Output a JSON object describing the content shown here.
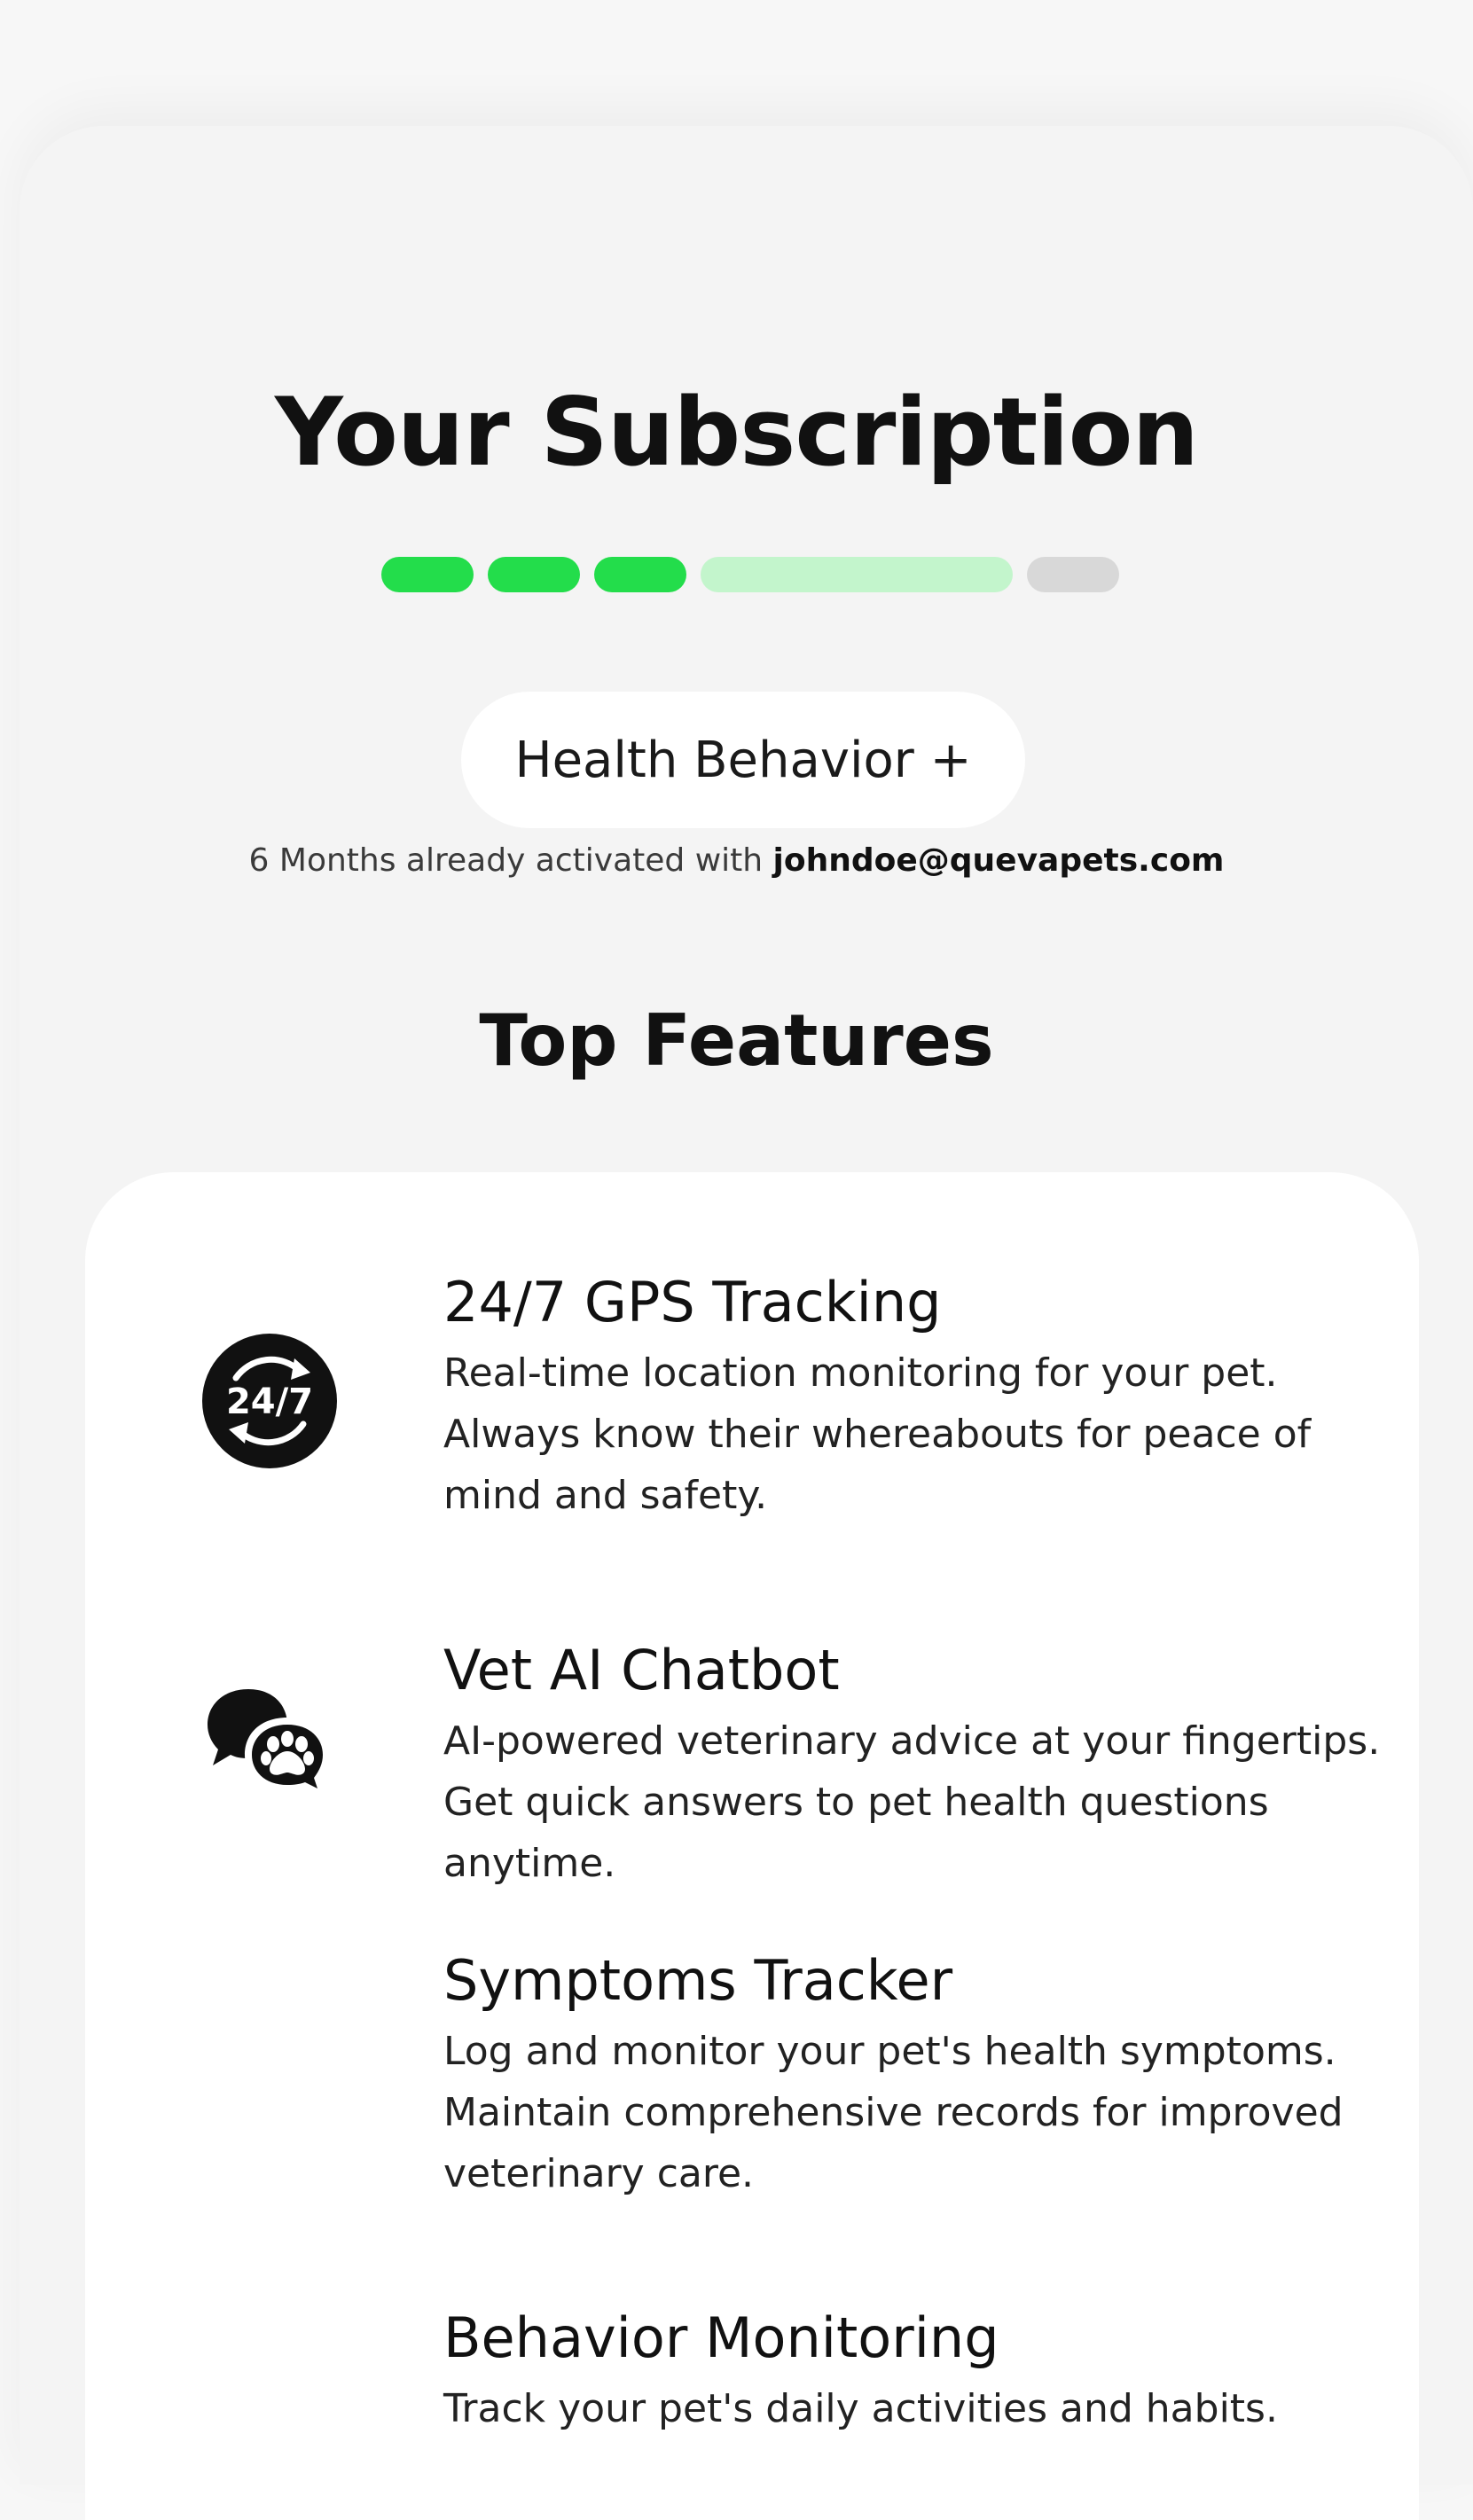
{
  "page": {
    "title": "Your Subscription",
    "progress": {
      "steps": [
        "complete",
        "complete",
        "complete",
        "current",
        "pending"
      ],
      "colors": {
        "complete": "#23dd4b",
        "current": "#c3f5cc",
        "pending": "#d8d8d8"
      }
    },
    "plan": {
      "label": "Health Behavior +"
    },
    "activation": {
      "text": "6 Months already activated with ",
      "email": "johndoe@quevapets.com"
    },
    "features": {
      "heading": "Top Features",
      "items": [
        {
          "title": "24/7 GPS Tracking",
          "description": "Real-time location monitoring for your pet. Always know their whereabouts for peace of mind and safety.",
          "icon": "24-7-icon",
          "icon_text": "24/7"
        },
        {
          "title": "Vet AI Chatbot",
          "description": "AI-powered veterinary advice at your fingertips. Get quick answers to pet health questions anytime.",
          "icon": "chat-paw-icon"
        },
        {
          "title": "Symptoms Tracker",
          "description": "Log and monitor your pet's health symptoms. Maintain comprehensive records for improved veterinary care."
        },
        {
          "title": "Behavior Monitoring",
          "description": "Track your pet's daily activities and habits."
        }
      ]
    }
  }
}
